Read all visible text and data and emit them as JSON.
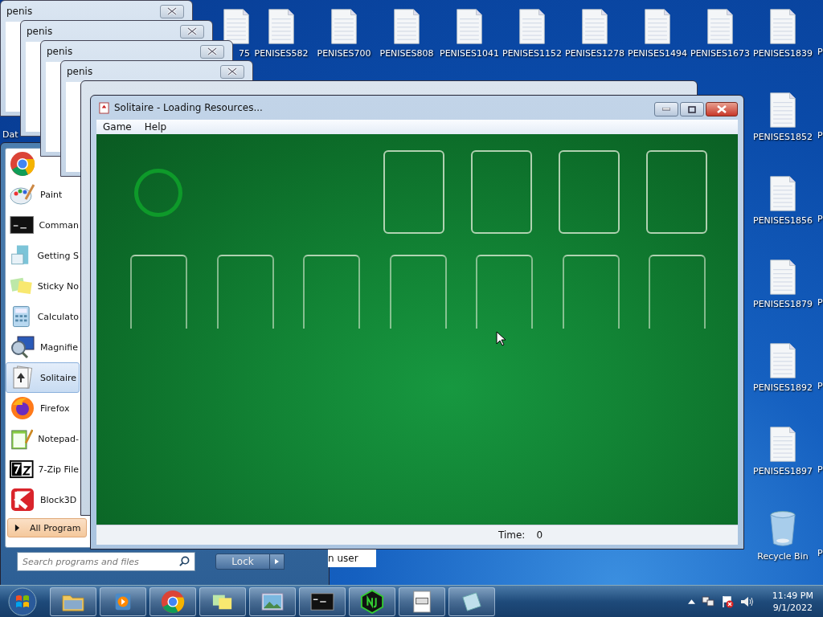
{
  "desktop": {
    "top_row_icons": [
      {
        "label": "75",
        "kind": "file"
      },
      {
        "label": "PENISES582",
        "kind": "file"
      },
      {
        "label": "PENISES700",
        "kind": "file"
      },
      {
        "label": "PENISES808",
        "kind": "file"
      },
      {
        "label": "PENISES1041",
        "kind": "file"
      },
      {
        "label": "PENISES1152",
        "kind": "file"
      },
      {
        "label": "PENISES1278",
        "kind": "file"
      },
      {
        "label": "PENISES1494",
        "kind": "file"
      },
      {
        "label": "PENISES1673",
        "kind": "file"
      },
      {
        "label": "PENISES1839",
        "kind": "file"
      }
    ],
    "right_column_icons": [
      {
        "label": "PENISES1852",
        "kind": "file"
      },
      {
        "label": "PENISES1856",
        "kind": "file"
      },
      {
        "label": "PENISES1879",
        "kind": "file"
      },
      {
        "label": "PENISES1892",
        "kind": "file"
      },
      {
        "label": "PENISES1897",
        "kind": "file"
      },
      {
        "label": "Recycle Bin",
        "kind": "recycle"
      }
    ],
    "edge_labels": [
      "P",
      "P",
      "P",
      "P",
      "P",
      "P",
      "P"
    ],
    "partial_label": "Dat"
  },
  "message_windows": [
    {
      "title": "penis"
    },
    {
      "title": "penis"
    },
    {
      "title": "penis"
    },
    {
      "title": "penis"
    }
  ],
  "start_menu": {
    "items": [
      {
        "selected": false
      },
      {
        "label": "Paint",
        "selected": false
      },
      {
        "label": "Comman",
        "selected": false
      },
      {
        "label": "Getting S",
        "selected": false
      },
      {
        "label": "Sticky No",
        "selected": false
      },
      {
        "label": "Calculato",
        "selected": false
      },
      {
        "label": "Magnifie",
        "selected": false
      },
      {
        "label": "Solitaire",
        "selected": true
      },
      {
        "label": "Firefox",
        "selected": false
      },
      {
        "label": "Notepad-",
        "selected": false
      },
      {
        "label": "7-Zip File",
        "selected": false
      },
      {
        "label": "Block3D",
        "selected": false
      }
    ],
    "all_programs": "All Program",
    "search": {
      "placeholder": "Search programs and files"
    },
    "lock_button": "Lock",
    "user_item": "n user"
  },
  "solitaire": {
    "title": "Solitaire - Loading Resources...",
    "menu": [
      "Game",
      "Help"
    ],
    "status": {
      "label": "Time:",
      "value": "0"
    }
  },
  "taskbar": {
    "time": "11:49 PM",
    "date": "9/1/2022"
  }
}
